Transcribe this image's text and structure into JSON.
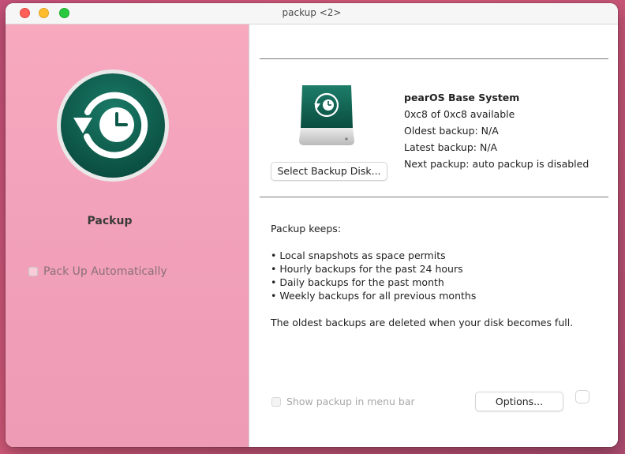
{
  "window": {
    "title": "packup <2>"
  },
  "sidebar": {
    "app_name": "Packup",
    "auto_label": "Pack Up Automatically",
    "auto_checked": false,
    "icon": "restore-clock-icon",
    "icon_color": "#0d5a4a"
  },
  "disk": {
    "icon": "hard-disk-icon",
    "select_button_label": "Select Backup Disk...",
    "name": "pearOS Base System",
    "available": "0xc8 of 0xc8 available",
    "oldest": "Oldest backup: N/A",
    "latest": "Latest backup: N/A",
    "next": "Next packup: auto packup is disabled"
  },
  "keeps": {
    "heading": "Packup keeps:",
    "items": [
      "• Local snapshots as space permits",
      "• Hourly backups for the past 24 hours",
      "• Daily backups for the past month",
      "• Weekly backups for all previous months"
    ],
    "footer": "The oldest backups are deleted when your disk becomes full."
  },
  "bottom": {
    "menubar_label": "Show packup in menu bar",
    "menubar_checked": false,
    "options_label": "Options..."
  },
  "colors": {
    "sidebar_pink": "#f3a2bb",
    "close": "#ff5f57",
    "minimize": "#febc2e",
    "maximize": "#28c840"
  }
}
